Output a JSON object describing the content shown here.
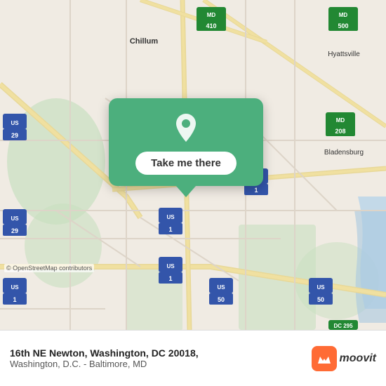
{
  "map": {
    "attribution": "© OpenStreetMap contributors",
    "background_color": "#e8e0d8"
  },
  "popup": {
    "button_label": "Take me there",
    "pin_color": "#ffffff",
    "card_color": "#4caf7d"
  },
  "bottom_bar": {
    "address_line1": "16th NE Newton, Washington, DC 20018,",
    "address_line2": "Washington, D.C. - Baltimore, MD",
    "logo_letter": "m",
    "logo_text": "moovit"
  }
}
